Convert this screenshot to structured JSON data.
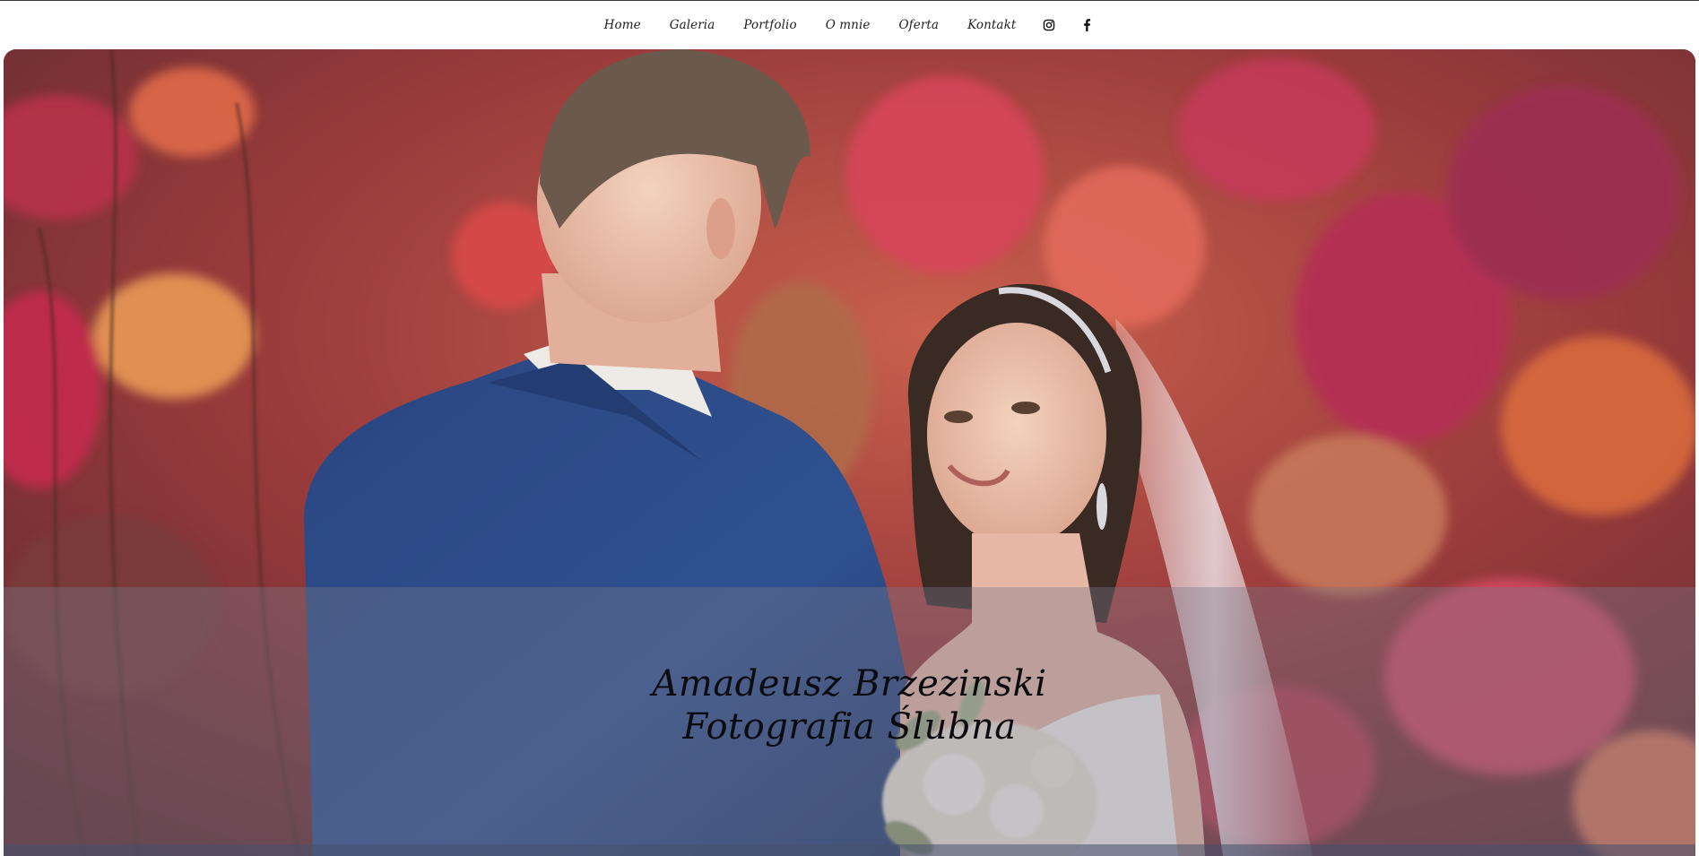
{
  "nav": {
    "items": [
      {
        "label": "Home"
      },
      {
        "label": "Galeria"
      },
      {
        "label": "Portfolio"
      },
      {
        "label": "O mnie"
      },
      {
        "label": "Oferta"
      },
      {
        "label": "Kontakt"
      }
    ],
    "icons": [
      "instagram-icon",
      "facebook-icon"
    ]
  },
  "hero": {
    "title_line1": "Amadeusz Brzezinski",
    "title_line2": "Fotografia Ślubna",
    "image": "wedding-couple-photo"
  },
  "colors": {
    "nav_text": "#222222",
    "title_text": "#0c0c10",
    "caption_band": "rgba(120,120,140,0.38)",
    "suit_blue": "#2f4f8e",
    "leaves_red": "#c23a4a"
  }
}
